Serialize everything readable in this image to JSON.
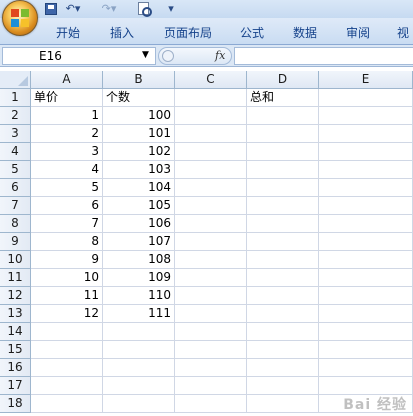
{
  "ribbon": {
    "tabs": [
      "开始",
      "插入",
      "页面布局",
      "公式",
      "数据",
      "审阅",
      "视"
    ]
  },
  "formula_bar": {
    "name_box_value": "E16",
    "fx_label": "fx",
    "formula_value": ""
  },
  "sheet": {
    "columns": [
      "A",
      "B",
      "C",
      "D",
      "E"
    ],
    "rows": [
      "1",
      "2",
      "3",
      "4",
      "5",
      "6",
      "7",
      "8",
      "9",
      "10",
      "11",
      "12",
      "13",
      "14",
      "15",
      "16",
      "17",
      "18"
    ],
    "cells": {
      "A1": "单价",
      "B1": "个数",
      "D1": "总和",
      "A2": "1",
      "B2": "100",
      "A3": "2",
      "B3": "101",
      "A4": "3",
      "B4": "102",
      "A5": "4",
      "B5": "103",
      "A6": "5",
      "B6": "104",
      "A7": "6",
      "B7": "105",
      "A8": "7",
      "B8": "106",
      "A9": "8",
      "B9": "107",
      "A10": "9",
      "B10": "108",
      "A11": "10",
      "B11": "109",
      "A12": "11",
      "B12": "110",
      "A13": "12",
      "B13": "111"
    }
  },
  "watermark": "Bai 经验"
}
